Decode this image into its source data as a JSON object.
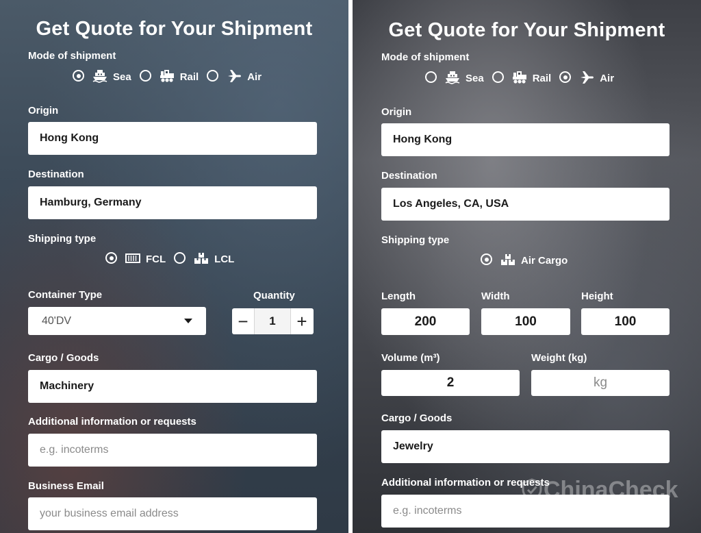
{
  "left": {
    "title": "Get Quote for Your Shipment",
    "mode_label": "Mode of shipment",
    "modes": [
      {
        "label": "Sea",
        "selected": true,
        "icon": "ship-icon"
      },
      {
        "label": "Rail",
        "selected": false,
        "icon": "train-icon"
      },
      {
        "label": "Air",
        "selected": false,
        "icon": "airplane-icon"
      }
    ],
    "origin_label": "Origin",
    "origin_value": "Hong Kong",
    "destination_label": "Destination",
    "destination_value": "Hamburg, Germany",
    "shipping_type_label": "Shipping type",
    "shipping_types": [
      {
        "label": "FCL",
        "selected": true,
        "icon": "container-icon"
      },
      {
        "label": "LCL",
        "selected": false,
        "icon": "boxes-icon"
      }
    ],
    "container_type_label": "Container Type",
    "container_type_value": "40'DV",
    "quantity_label": "Quantity",
    "quantity_value": "1",
    "cargo_label": "Cargo / Goods",
    "cargo_value": "Machinery",
    "additional_label": "Additional information or requests",
    "additional_placeholder": "e.g. incoterms",
    "email_label": "Business Email",
    "email_placeholder": "your business email address"
  },
  "right": {
    "title": "Get Quote for Your Shipment",
    "mode_label": "Mode of shipment",
    "modes": [
      {
        "label": "Sea",
        "selected": false,
        "icon": "ship-icon"
      },
      {
        "label": "Rail",
        "selected": false,
        "icon": "train-icon"
      },
      {
        "label": "Air",
        "selected": true,
        "icon": "airplane-icon"
      }
    ],
    "origin_label": "Origin",
    "origin_value": "Hong Kong",
    "destination_label": "Destination",
    "destination_value": "Los Angeles, CA, USA",
    "shipping_type_label": "Shipping type",
    "shipping_types": [
      {
        "label": "Air Cargo",
        "selected": true,
        "icon": "boxes-icon"
      }
    ],
    "length_label": "Length",
    "length_value": "200",
    "width_label": "Width",
    "width_value": "100",
    "height_label": "Height",
    "height_value": "100",
    "volume_label": "Volume (m³)",
    "volume_value": "2",
    "weight_label": "Weight (kg)",
    "weight_placeholder": "kg",
    "cargo_label": "Cargo / Goods",
    "cargo_value": "Jewelry",
    "additional_label": "Additional information or requests",
    "additional_placeholder": "e.g. incoterms"
  },
  "watermark": "ChinaCheck",
  "colors": {
    "field_bg": "#ffffff",
    "label_text": "#ffffff",
    "placeholder": "#8a8a8a"
  }
}
